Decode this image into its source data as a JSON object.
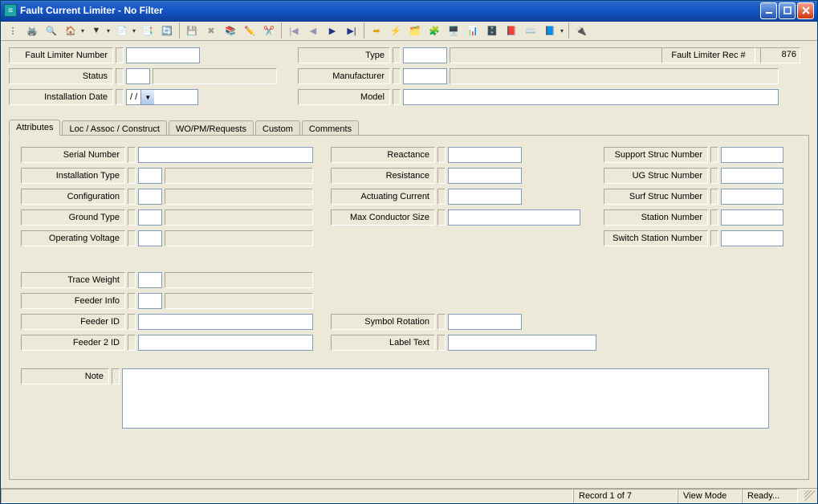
{
  "window": {
    "title": "Fault Current Limiter - No Filter"
  },
  "toolbar_icons": [
    "📄",
    "🖨️",
    "🔍",
    "🏠",
    "▾",
    "🔻",
    "▾",
    "📄",
    "▾",
    "📑",
    "↪️",
    "| ",
    "💾",
    "✖️",
    "📚",
    "✏️",
    "✂️",
    "| ",
    "⏮",
    "◀",
    "▶",
    "⏭",
    "| ",
    "➡️",
    "⚡",
    "🗂️",
    "🗺️",
    "🖥️",
    "📊",
    "🗄️",
    "📕",
    "⌨️",
    "📘",
    "| ",
    "🔌"
  ],
  "header": {
    "fault_limiter_number_label": "Fault Limiter Number",
    "type_label": "Type",
    "status_label": "Status",
    "manufacturer_label": "Manufacturer",
    "installation_date_label": "Installation Date",
    "installation_date_value": "  /   /",
    "model_label": "Model",
    "rec_label": "Fault Limiter Rec #",
    "rec_value": "876"
  },
  "tabs": {
    "t0": "Attributes",
    "t1": "Loc / Assoc / Construct",
    "t2": "WO/PM/Requests",
    "t3": "Custom",
    "t4": "Comments"
  },
  "attrs": {
    "serial_number": "Serial Number",
    "installation_type": "Installation Type",
    "configuration": "Configuration",
    "ground_type": "Ground Type",
    "operating_voltage": "Operating Voltage",
    "trace_weight": "Trace Weight",
    "feeder_info": "Feeder Info",
    "feeder_id": "Feeder ID",
    "feeder2_id": "Feeder 2 ID",
    "reactance": "Reactance",
    "resistance": "Resistance",
    "actuating_current": "Actuating Current",
    "max_conductor": "Max Conductor Size",
    "symbol_rotation": "Symbol Rotation",
    "label_text": "Label Text",
    "support_struc": "Support Struc Number",
    "ug_struc": "UG Struc Number",
    "surf_struc": "Surf Struc Number",
    "station_number": "Station Number",
    "switch_station": "Switch Station Number",
    "note": "Note"
  },
  "status": {
    "record": "Record 1 of 7",
    "mode": "View Mode",
    "ready": "Ready..."
  }
}
